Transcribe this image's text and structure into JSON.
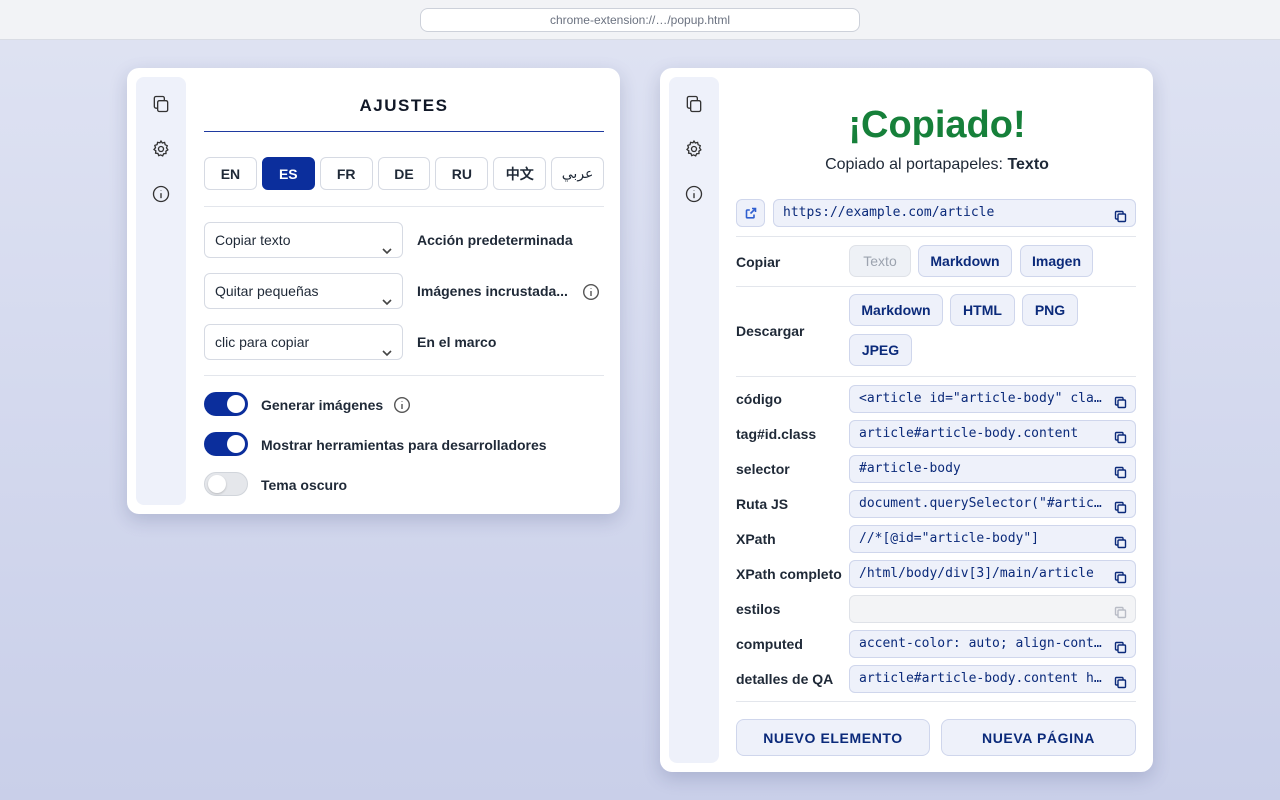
{
  "browser": {
    "url": "chrome-extension://…/popup.html"
  },
  "colors": {
    "accent": "#0b2e9c",
    "success": "#16803a",
    "chip_bg": "#eef1fa"
  },
  "sidebar_icons": [
    "copy-icon",
    "gear-icon",
    "info-icon"
  ],
  "settings": {
    "title": "AJUSTES",
    "languages": [
      "EN",
      "ES",
      "FR",
      "DE",
      "RU",
      "中文",
      "عربي"
    ],
    "active_language": "ES",
    "rows": [
      {
        "value": "Copiar texto",
        "label": "Acción predeterminada"
      },
      {
        "value": "Quitar pequeñas",
        "label": "Imágenes incrustada..."
      },
      {
        "value": "clic para copiar",
        "label": "En el marco"
      }
    ],
    "toggles": [
      {
        "label": "Generar imágenes",
        "on": true
      },
      {
        "label": "Mostrar herramientas para desarrolladores",
        "on": true
      },
      {
        "label": "Tema oscuro",
        "on": false
      }
    ]
  },
  "copied": {
    "title": "¡Copiado!",
    "subtitle_prefix": "Copiado al portapapeles:",
    "subtitle_value": "Texto",
    "url": "https://example.com/article",
    "copy_label": "Copiar",
    "copy_options": [
      "Texto",
      "Markdown",
      "Imagen"
    ],
    "download_label": "Descargar",
    "download_options": [
      "Markdown",
      "HTML",
      "PNG",
      "JPEG"
    ],
    "properties": [
      {
        "label": "código",
        "value": "<article id=\"article-body\" class=\"content\">"
      },
      {
        "label": "tag#id.class",
        "value": "article#article-body.content"
      },
      {
        "label": "selector",
        "value": "#article-body"
      },
      {
        "label": "Ruta JS",
        "value": "document.querySelector(\"#article-body\")"
      },
      {
        "label": "XPath",
        "value": "//*[@id=\"article-body\"]"
      },
      {
        "label": "XPath completo",
        "value": "/html/body/div[3]/main/article"
      },
      {
        "label": "estilos",
        "value": ""
      },
      {
        "label": "computed",
        "value": "accent-color: auto; align-content: normal;"
      },
      {
        "label": "detalles de QA",
        "value": "article#article-body.content html body"
      }
    ],
    "new_element": "NUEVO ELEMENTO",
    "new_page": "NUEVA PÁGINA"
  }
}
